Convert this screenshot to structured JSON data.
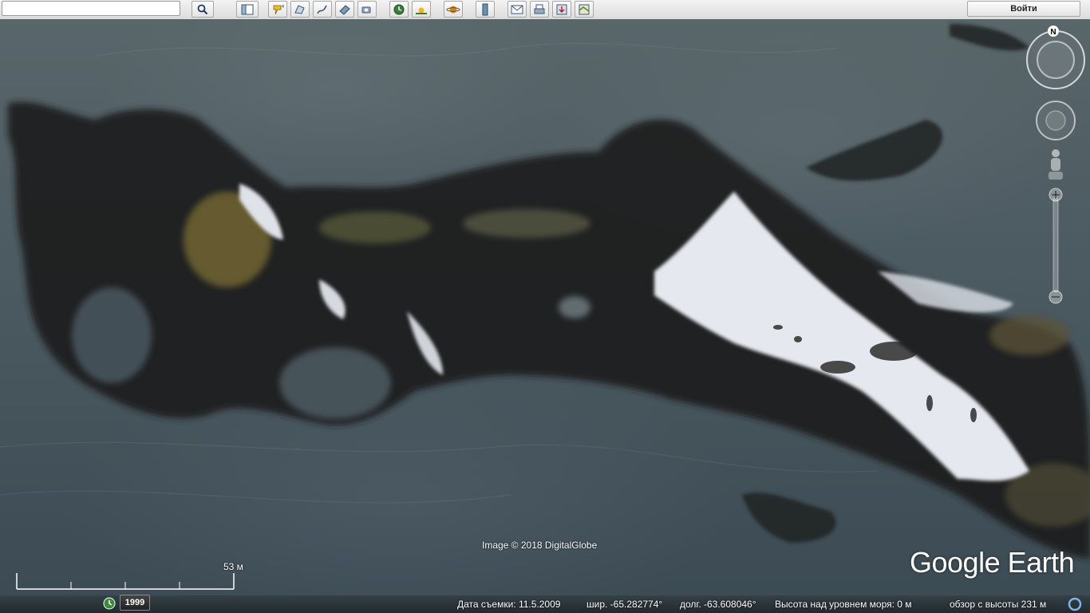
{
  "toolbar": {
    "search_placeholder": "",
    "login_label": "Войти",
    "buttons": [
      {
        "name": "search-icon",
        "glyph": "⌕"
      },
      {
        "name": "sidebar-toggle-icon",
        "glyph": "▥"
      },
      {
        "name": "add-placemark-icon",
        "glyph": "★"
      },
      {
        "name": "add-polygon-icon",
        "glyph": "⬠"
      },
      {
        "name": "add-path-icon",
        "glyph": "⤳"
      },
      {
        "name": "image-overlay-icon",
        "glyph": "▤"
      },
      {
        "name": "record-tour-icon",
        "glyph": "◉"
      },
      {
        "name": "historical-imagery-icon",
        "glyph": "◷"
      },
      {
        "name": "sunlight-icon",
        "glyph": "☀"
      },
      {
        "name": "planets-icon",
        "glyph": "♄"
      },
      {
        "name": "ruler-icon",
        "glyph": "┆"
      },
      {
        "name": "email-icon",
        "glyph": "✉"
      },
      {
        "name": "print-icon",
        "glyph": "⎙"
      },
      {
        "name": "save-image-icon",
        "glyph": "⇩"
      },
      {
        "name": "view-in-maps-icon",
        "glyph": "▦"
      }
    ]
  },
  "map": {
    "imagery_credit": "Image © 2018 DigitalGlobe",
    "logo_text": "Google Earth",
    "compass_north": "N"
  },
  "scale": {
    "label": "53 м"
  },
  "history": {
    "year": "1999"
  },
  "status": {
    "date_label": "Дата съемки: 11.5.2009",
    "lat": "шир.   -65.282774°",
    "lon": "долг.   -63.608046°",
    "elevation": "Высота над уровнем моря:     0 м",
    "eye_alt": "обзор с высоты    231 м"
  }
}
